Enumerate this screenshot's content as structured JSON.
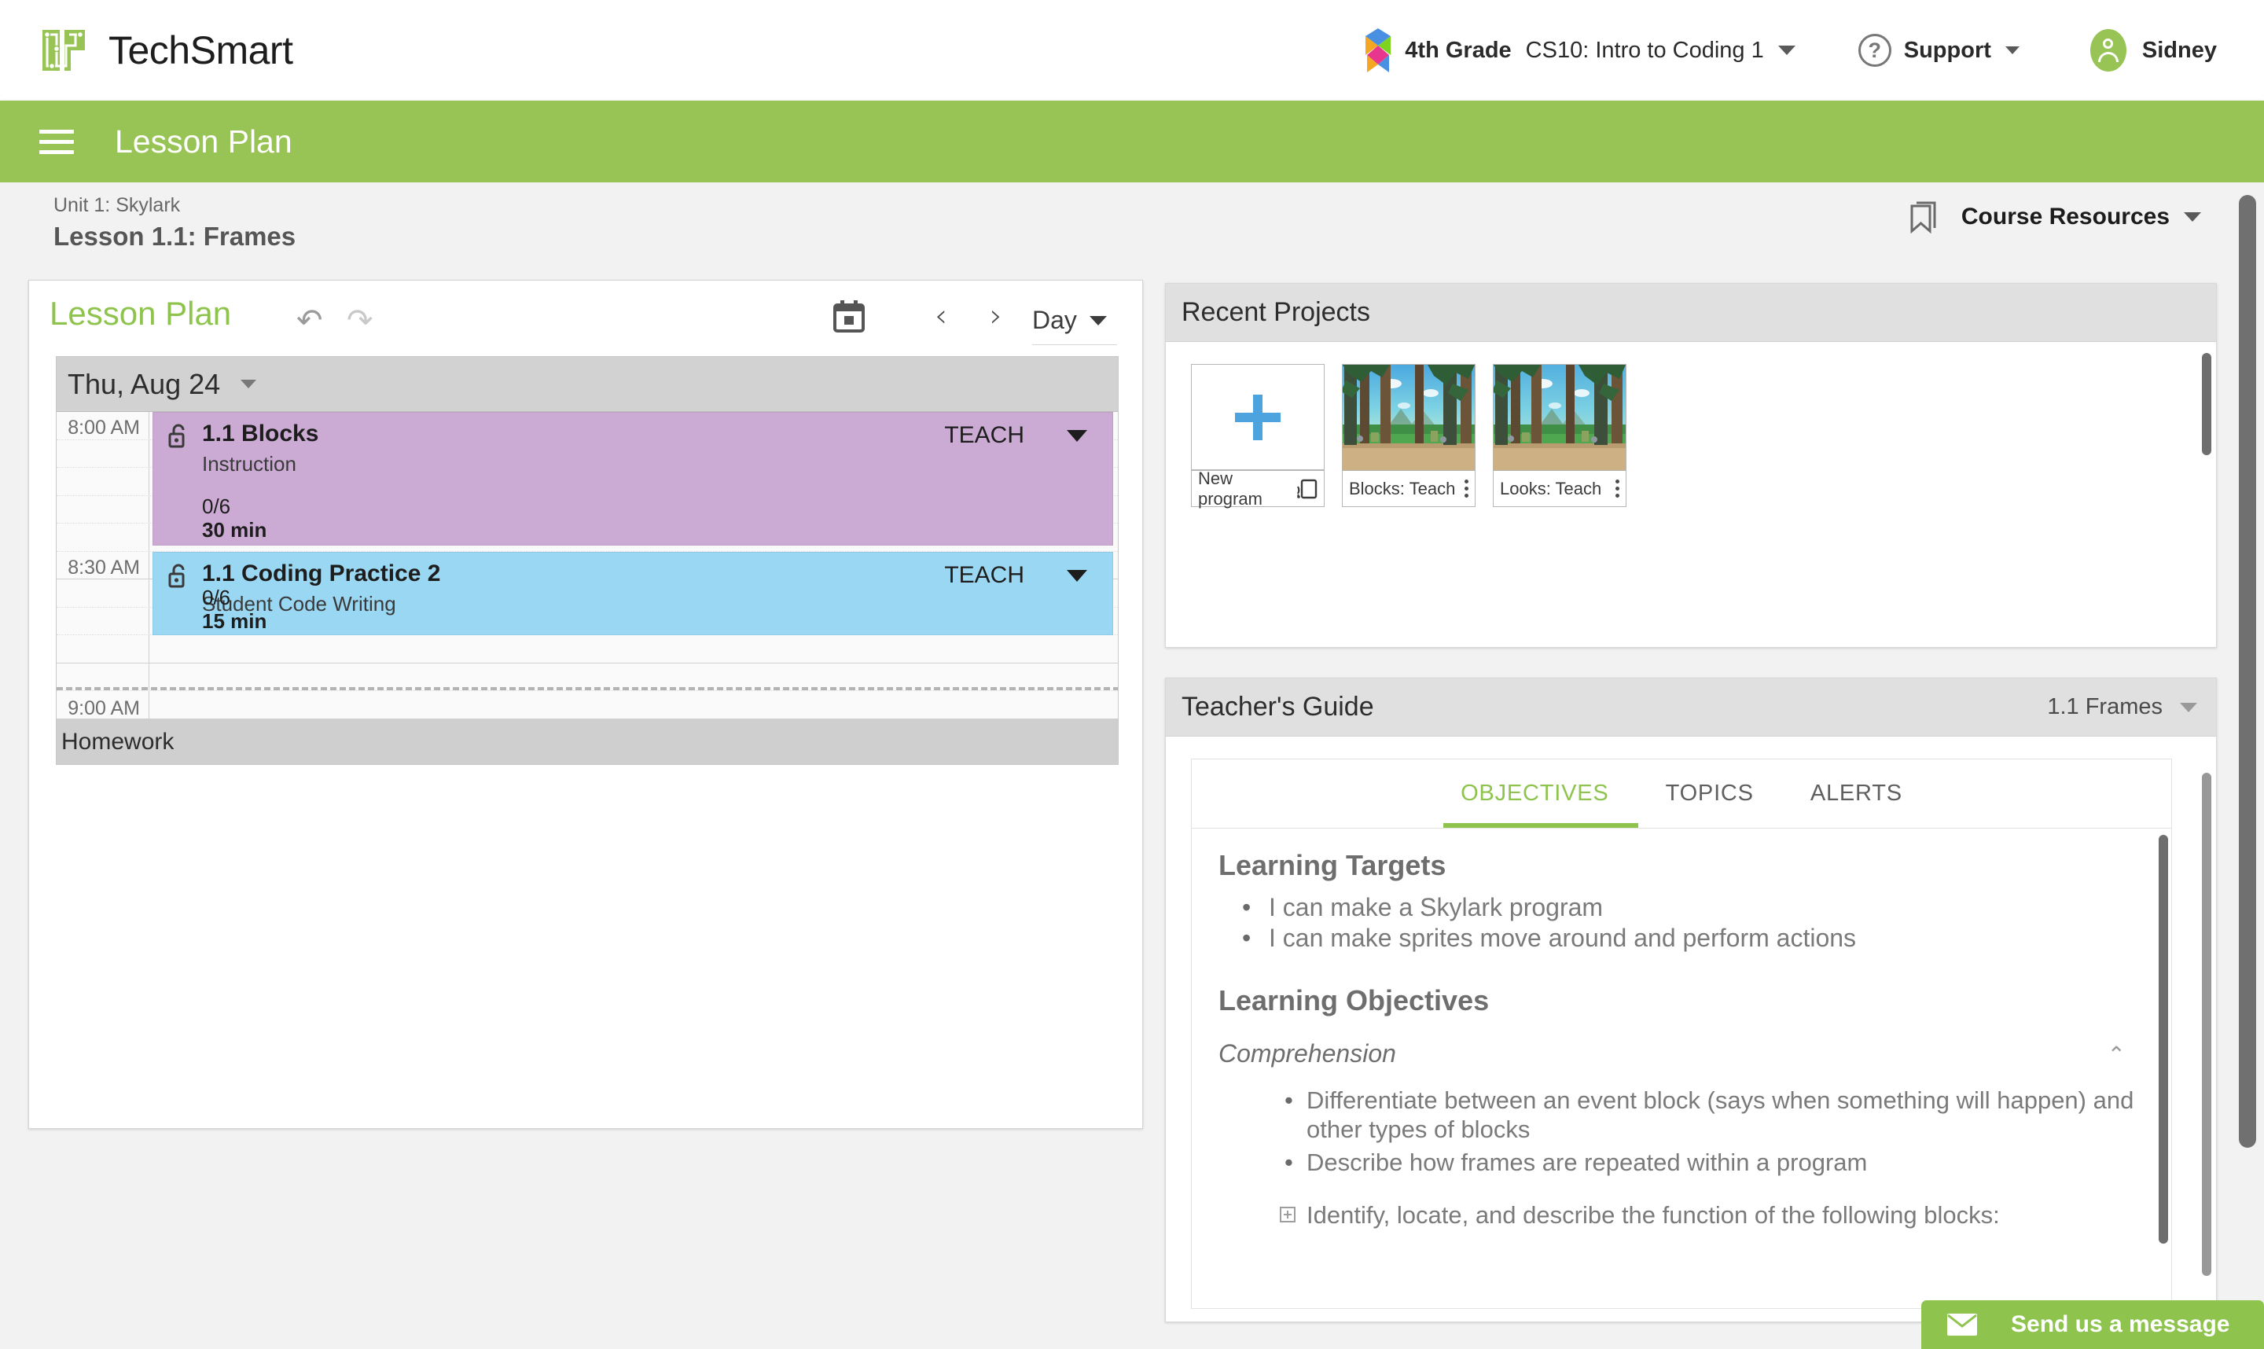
{
  "topbar": {
    "brand": "TechSmart",
    "grade": "4th Grade",
    "course": "CS10: Intro to Coding 1",
    "support": "Support",
    "user": "Sidney"
  },
  "greenbar": {
    "title": "Lesson Plan"
  },
  "breadcrumb": {
    "unit": "Unit 1: Skylark",
    "lesson": "Lesson 1.1: Frames",
    "course_resources": "Course Resources"
  },
  "lesson_plan": {
    "title": "Lesson Plan",
    "undo_glyph": "↶",
    "redo_glyph": "↷",
    "prev_glyph": "‹",
    "next_glyph": "›",
    "view_mode": "Day",
    "day_label": "Thu, Aug 24",
    "time_labels": [
      "8:00 AM",
      "8:30 AM",
      "9:00 AM"
    ],
    "homework_label": "Homework",
    "events": [
      {
        "title": "1.1 Blocks",
        "subtitle": "Instruction",
        "action": "TEACH",
        "count": "0/6",
        "duration": "30 min",
        "color": "#cbaad4"
      },
      {
        "title": "1.1 Coding Practice 2",
        "subtitle": "Student Code Writing",
        "action": "TEACH",
        "count": "0/6",
        "duration": "15 min",
        "color": "#9ad7f3"
      }
    ]
  },
  "recent_projects": {
    "title": "Recent Projects",
    "cards": [
      {
        "name": "New program",
        "type": "new"
      },
      {
        "name": "Blocks: Teach",
        "type": "thumb"
      },
      {
        "name": "Looks: Teach",
        "type": "thumb"
      }
    ]
  },
  "teachers_guide": {
    "title": "Teacher's Guide",
    "selected_lesson": "1.1 Frames",
    "tabs": [
      {
        "label": "OBJECTIVES",
        "active": true
      },
      {
        "label": "TOPICS",
        "active": false
      },
      {
        "label": "ALERTS",
        "active": false
      }
    ],
    "learning_targets_heading": "Learning Targets",
    "learning_targets": [
      "I can make a Skylark program",
      "I can make sprites move around and perform actions"
    ],
    "learning_objectives_heading": "Learning Objectives",
    "objective_group": "Comprehension",
    "objectives": [
      "Differentiate between an event block (says when something will happen) and other types of blocks",
      "Describe how frames are repeated within a program"
    ],
    "expandable_objective": "Identify, locate, and describe the function of the following blocks:",
    "collapse_glyph": "⌃"
  },
  "chat": {
    "label": "Send us a message"
  },
  "colors": {
    "brand_green": "#97c455",
    "accent_green": "#8ec44d",
    "event_purple": "#cbaad4",
    "event_blue": "#9ad7f3",
    "page_bg": "#f2f2f2"
  }
}
